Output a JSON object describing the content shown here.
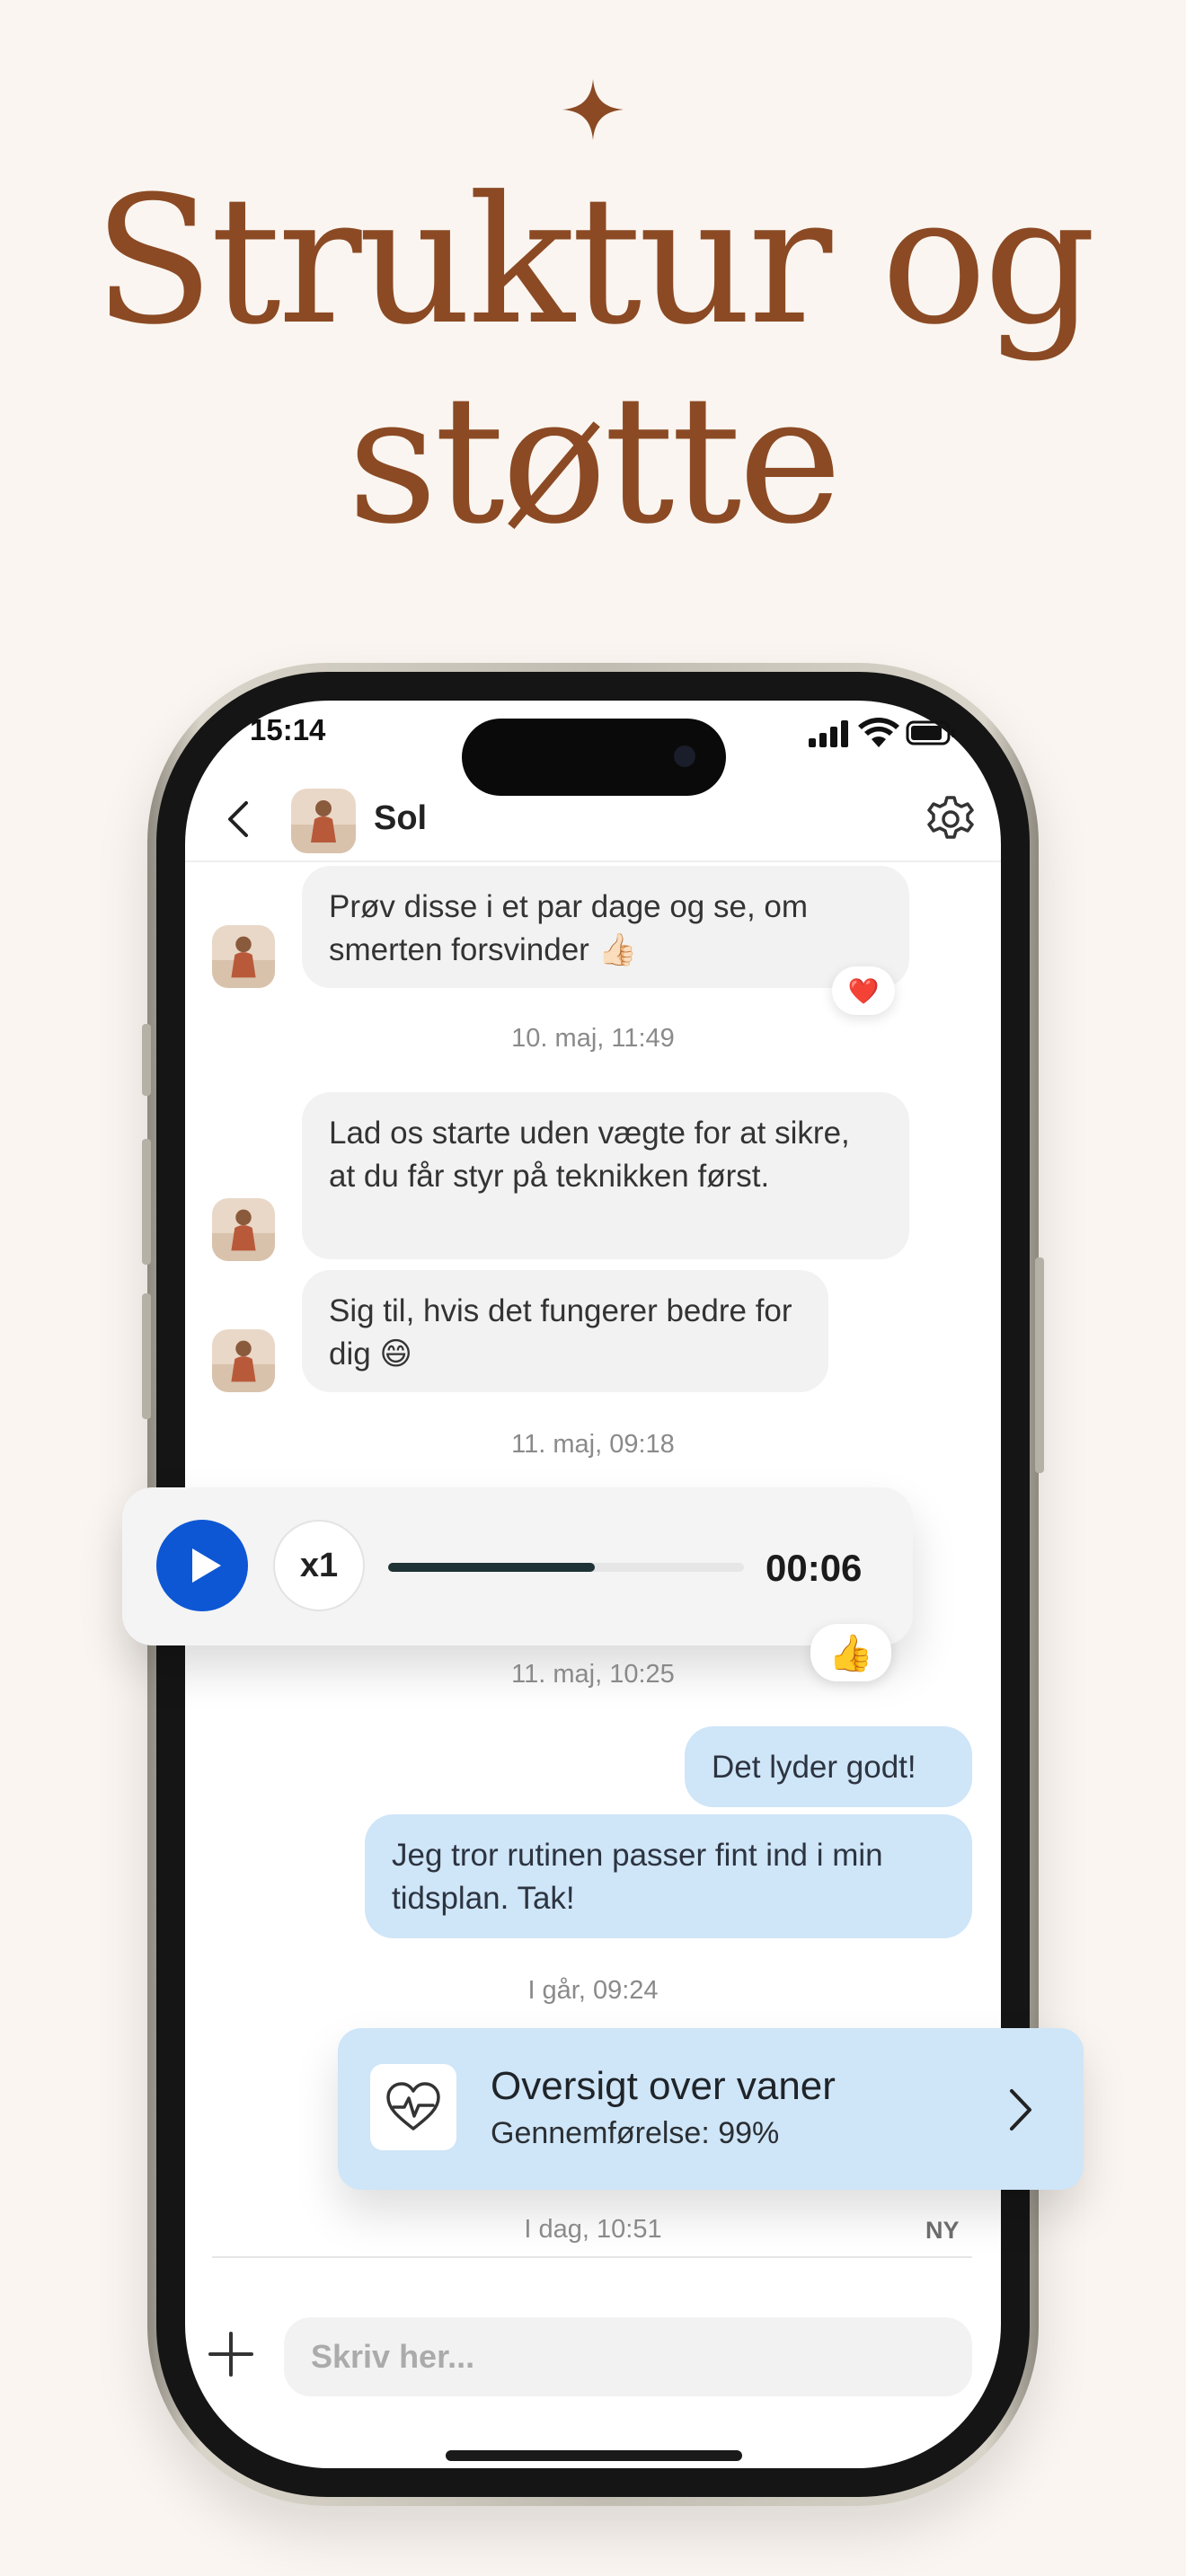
{
  "headline": {
    "line1": "Struktur og",
    "line2": "støtte"
  },
  "status_bar": {
    "time": "15:14"
  },
  "chat_header": {
    "contact_name": "Sol"
  },
  "messages": {
    "m1": "Prøv disse i et par dage og se, om smerten forsvinder 👍🏻",
    "m1_reaction": "❤️",
    "ts1": "10. maj, 11:49",
    "m2": "Lad os starte uden vægte for at sikre, at du får styr på teknikken først.",
    "m3": "Sig til, hvis det fungerer bedre for dig 😄",
    "ts2": "11. maj, 09:18",
    "voice": {
      "speed": "x1",
      "duration": "00:06",
      "progress": 0.58,
      "reaction": "👍"
    },
    "ts3": "11. maj, 10:25",
    "m4": "Det lyder godt!",
    "m5": "Jeg tror rutinen passer fint ind i min tidsplan. Tak!",
    "ts4": "I går, 09:24",
    "habit_card": {
      "title": "Oversigt over vaner",
      "subtitle": "Gennemførelse: 99%"
    },
    "ts5": "I dag, 10:51",
    "new_badge": "NY"
  },
  "composer": {
    "placeholder": "Skriv her..."
  },
  "colors": {
    "headline": "#8B4A24",
    "accent": "#0D57D5",
    "bubble_out": "#CFE5F8",
    "bubble_in": "#F2F2F2",
    "background": "#FAF5F0"
  }
}
